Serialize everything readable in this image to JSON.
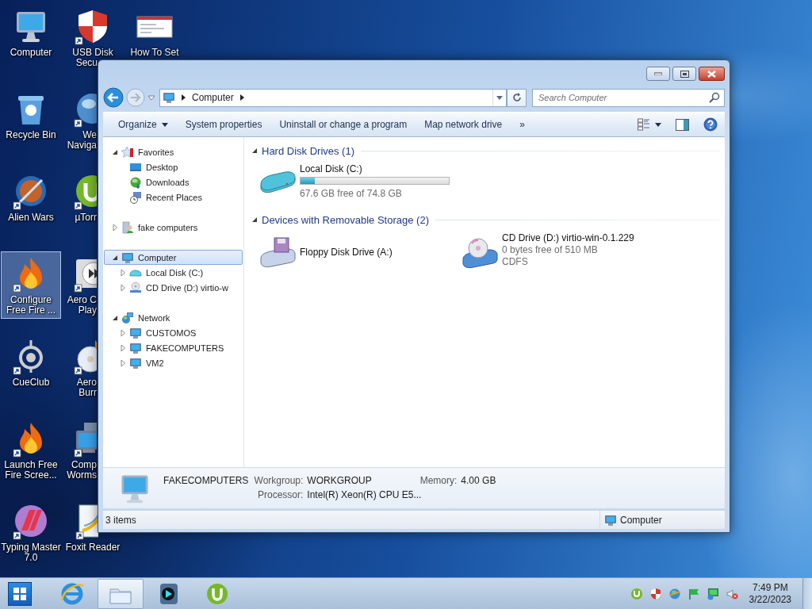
{
  "desktop": {
    "columns": [
      [
        {
          "lines": [
            "Computer"
          ],
          "selected": false
        },
        {
          "lines": [
            "Recycle Bin"
          ],
          "selected": false
        },
        {
          "lines": [
            "Alien Wars"
          ],
          "selected": false
        },
        {
          "lines": [
            "Configure",
            "Free Fire ..."
          ],
          "selected": true
        },
        {
          "lines": [
            "CueClub"
          ],
          "selected": false
        },
        {
          "lines": [
            "Launch Free",
            "Fire Scree..."
          ],
          "selected": false
        },
        {
          "lines": [
            "Typing Master",
            "7.0"
          ],
          "selected": false
        }
      ],
      [
        {
          "lines": [
            "USB Disk",
            "Secu"
          ],
          "selected": false
        },
        {
          "lines": [
            "We",
            "Naviga"
          ],
          "selected": false
        },
        {
          "lines": [
            "µTorr"
          ],
          "selected": false
        },
        {
          "lines": [
            "Aero C",
            "Play"
          ],
          "selected": false
        },
        {
          "lines": [
            "Aero",
            "Burr"
          ],
          "selected": false
        },
        {
          "lines": [
            "Comp",
            "Worms"
          ],
          "selected": false
        },
        {
          "lines": [
            "Foxit Reader"
          ],
          "selected": false
        }
      ],
      [
        {
          "lines": [
            "How To Set"
          ],
          "selected": false
        }
      ]
    ]
  },
  "explorer": {
    "address": {
      "crumbs": [
        "Computer"
      ]
    },
    "search": {
      "placeholder": "Search Computer"
    },
    "commands": [
      {
        "label": "Organize",
        "menu": true
      },
      {
        "label": "System properties",
        "menu": false
      },
      {
        "label": "Uninstall or change a program",
        "menu": false
      },
      {
        "label": "Map network drive",
        "menu": false
      }
    ],
    "more": "»",
    "nav": [
      {
        "label": "Favorites",
        "expanded": true,
        "selected": false,
        "children": [
          {
            "label": "Desktop",
            "selected": false
          },
          {
            "label": "Downloads",
            "selected": false
          },
          {
            "label": "Recent Places",
            "selected": false
          }
        ]
      },
      {
        "label": "fake computers",
        "expanded": false,
        "selected": false
      },
      {
        "label": "Computer",
        "expanded": true,
        "selected": true,
        "children": [
          {
            "label": "Local Disk (C:)",
            "expanded": false,
            "selected": false
          },
          {
            "label": "CD Drive (D:) virtio-w",
            "expanded": false,
            "selected": false
          }
        ]
      },
      {
        "label": "Network",
        "expanded": true,
        "selected": false,
        "children": [
          {
            "label": "CUSTOMOS",
            "expanded": false,
            "selected": false
          },
          {
            "label": "FAKECOMPUTERS",
            "expanded": false,
            "selected": false
          },
          {
            "label": "VM2",
            "expanded": false,
            "selected": false
          }
        ]
      }
    ],
    "groups": [
      {
        "title": "Hard Disk Drives (1)",
        "expanded": true,
        "items": [
          {
            "kind": "hard_disk",
            "name": "Local Disk (C:)",
            "level": 0.096,
            "lines": [
              "67.6 GB free of 74.8 GB"
            ]
          }
        ]
      },
      {
        "title": "Devices with Removable Storage (2)",
        "expanded": true,
        "items": [
          {
            "kind": "floppy",
            "name": "Floppy Disk Drive (A:)"
          },
          {
            "kind": "cd_drive",
            "name": "CD Drive (D:) virtio-win-0.1.229",
            "lines": [
              "0 bytes free of 510 MB",
              "CDFS"
            ]
          }
        ]
      }
    ],
    "details": {
      "name": "FAKECOMPUTERS",
      "fields": [
        {
          "label": "Workgroup:",
          "value": "WORKGROUP"
        },
        {
          "label": "Memory:",
          "value": "4.00 GB"
        },
        {
          "label": "Processor:",
          "value": "Intel(R) Xeon(R) CPU E5..."
        }
      ]
    },
    "status": {
      "count": "3 items",
      "location": "Computer"
    }
  },
  "taskbar": {
    "apps": [
      {
        "active": false
      },
      {
        "active": true
      },
      {
        "active": false
      },
      {
        "active": false
      }
    ],
    "clock": {
      "time": "7:49 PM",
      "date": "3/22/2023"
    }
  }
}
